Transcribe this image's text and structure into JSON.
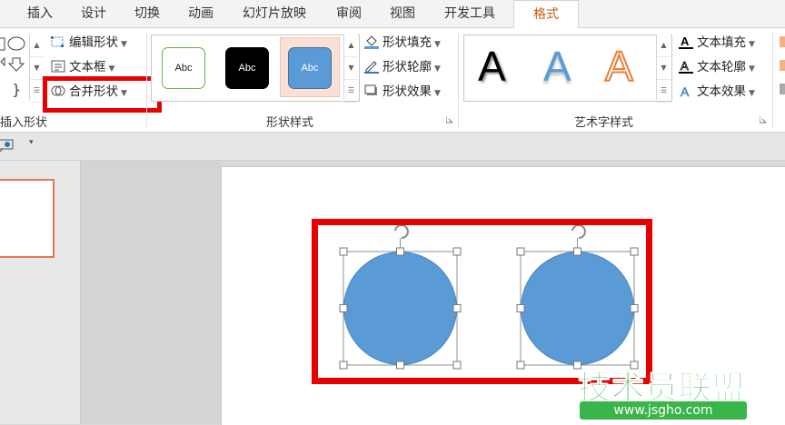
{
  "tabs": [
    "插入",
    "设计",
    "切换",
    "动画",
    "幻灯片放映",
    "审阅",
    "视图",
    "开发工具",
    "格式"
  ],
  "active_tab": "格式",
  "insert_shapes": {
    "group_label": "插入形状",
    "edit_shape": "编辑形状",
    "text_box": "文本框",
    "merge_shapes": "合并形状"
  },
  "shape_styles": {
    "group_label": "形状样式",
    "preset_label": "Abc",
    "fill": "形状填充",
    "outline": "形状轮廓",
    "effects": "形状效果"
  },
  "wordart_styles": {
    "group_label": "艺术字样式",
    "preset_letter": "A",
    "text_fill": "文本填充",
    "text_outline": "文本轮廓",
    "text_effects": "文本效果"
  },
  "watermark": {
    "title": "技术员联盟",
    "url": "www.jsgho.com"
  },
  "colors": {
    "accent_tab": "#c55a11",
    "highlight_red": "#e80000",
    "shape_fill": "#5b9bd5",
    "watermark_green": "#39b54a"
  },
  "shapes": [
    "circle-left",
    "circle-right"
  ]
}
